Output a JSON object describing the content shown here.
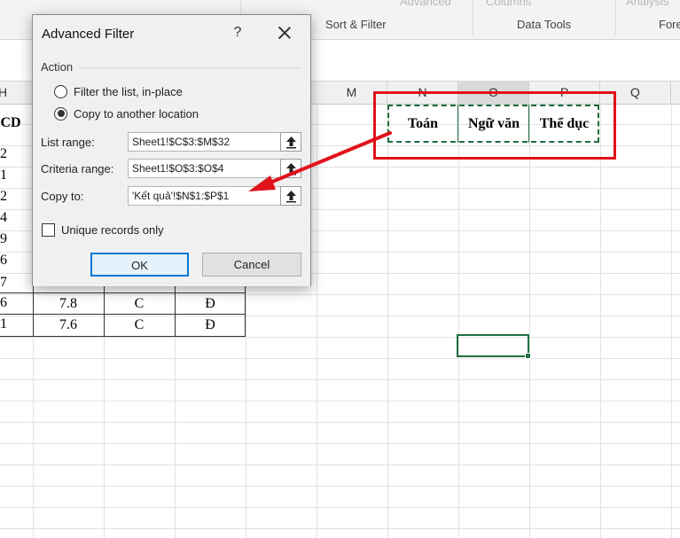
{
  "ribbon": {
    "faded_left": "Advanced",
    "faded_mid": "Columns",
    "faded_right": "Analysis",
    "groups": [
      "Sort & Filter",
      "Data Tools",
      "Fore"
    ]
  },
  "columns": {
    "left": "H",
    "m": "M",
    "n": "N",
    "o": "O",
    "p": "P",
    "q": "Q"
  },
  "sheet": {
    "header_partial": "CD",
    "left_col": [
      "2",
      "1",
      "2",
      "4",
      "9",
      "6",
      "7",
      "6",
      "1"
    ],
    "row_values": [
      {
        "score": "7.8",
        "grade": "C",
        "status": "Đ"
      },
      {
        "score": "7.6",
        "grade": "C",
        "status": "Đ"
      }
    ],
    "partial_row": {
      "score": "7.6",
      "grade": "C",
      "status": "Đ"
    }
  },
  "criteria": {
    "headers": [
      "Toán",
      "Ngữ văn",
      "Thể dục"
    ]
  },
  "dialog": {
    "title": "Advanced Filter",
    "help": "?",
    "section": "Action",
    "radio_filter": "Filter the list, in-place",
    "radio_copy": "Copy to another location",
    "selected": "copy",
    "list_range_label": "List range:",
    "list_range_value": "Sheet1!$C$3:$M$32",
    "criteria_range_label": "Criteria range:",
    "criteria_range_value": "Sheet1!$O$3:$O$4",
    "copy_to_label": "Copy to:",
    "copy_to_value": "'Kết quả'!$N$1:$P$1",
    "unique_label": "Unique records only",
    "unique_checked": false,
    "ok_label": "OK",
    "cancel_label": "Cancel"
  },
  "colors": {
    "annotation_red": "#e0121b",
    "excel_green": "#1e7145",
    "ok_border": "#0078d7"
  }
}
